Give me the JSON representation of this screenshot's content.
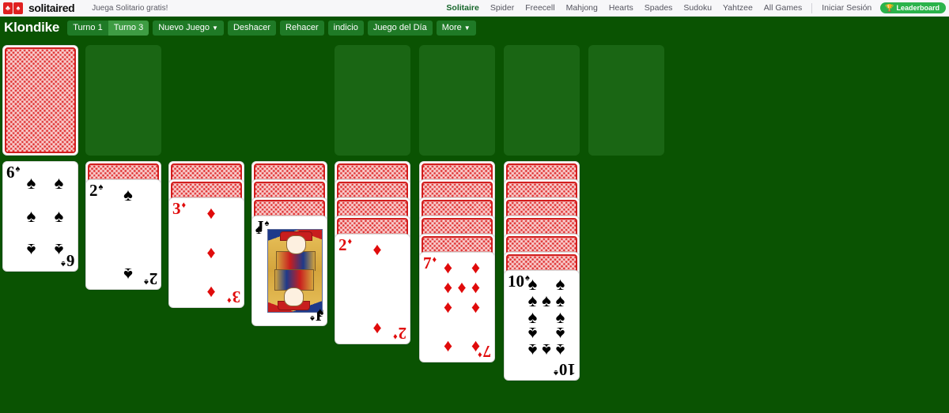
{
  "header": {
    "brand": "solitaired",
    "tagline": "Juega Solitario gratis!",
    "logo_card_1": "club-card-icon",
    "logo_card_2": "spade-card-icon",
    "nav_items": [
      {
        "label": "Solitaire",
        "active": true
      },
      {
        "label": "Spider",
        "active": false
      },
      {
        "label": "Freecell",
        "active": false
      },
      {
        "label": "Mahjong",
        "active": false
      },
      {
        "label": "Hearts",
        "active": false
      },
      {
        "label": "Spades",
        "active": false
      },
      {
        "label": "Sudoku",
        "active": false
      },
      {
        "label": "Yahtzee",
        "active": false
      },
      {
        "label": "All Games",
        "active": false
      }
    ],
    "login_label": "Iniciar Sesión",
    "leaderboard_label": "Leaderboard",
    "leaderboard_icon": "trophy-icon"
  },
  "toolbar": {
    "game_title": "Klondike",
    "turn1_label": "Turno 1",
    "turn3_label": "Turno 3",
    "turn_active": "Turno 3",
    "new_game_label": "Nuevo Juego",
    "undo_label": "Deshacer",
    "redo_label": "Rehacer",
    "hint_label": "indicio",
    "daily_label": "Juego del Día",
    "more_label": "More",
    "caret_icon": "chevron-down-icon"
  },
  "colors": {
    "table_green": "#0a5302",
    "slot_green": "#1a6614",
    "button_green": "#1f7a26",
    "button_active_green": "#3e9c43",
    "accent_green": "#2bb34b",
    "card_red": "#e00b0b",
    "card_back_red": "#e03030"
  },
  "board": {
    "stock": {
      "name": "stock-pile",
      "face_down_count": 1,
      "empty": false
    },
    "waste": {
      "name": "waste-pile",
      "empty": true
    },
    "foundations": [
      {
        "name": "foundation-1",
        "empty": true
      },
      {
        "name": "foundation-2",
        "empty": true
      },
      {
        "name": "foundation-3",
        "empty": true
      },
      {
        "name": "foundation-4",
        "empty": true
      }
    ],
    "tableau": [
      {
        "column": 1,
        "face_down": 0,
        "face_up": [
          {
            "rank": "6",
            "suit": "♠",
            "color": "black",
            "pips": 6
          }
        ]
      },
      {
        "column": 2,
        "face_down": 1,
        "face_up": [
          {
            "rank": "2",
            "suit": "♠",
            "color": "black",
            "pips": 2
          }
        ]
      },
      {
        "column": 3,
        "face_down": 2,
        "face_up": [
          {
            "rank": "3",
            "suit": "♦",
            "color": "red",
            "pips": 3
          }
        ]
      },
      {
        "column": 4,
        "face_down": 3,
        "face_up": [
          {
            "rank": "J",
            "suit": "♠",
            "color": "black",
            "pips": 0
          }
        ]
      },
      {
        "column": 5,
        "face_down": 4,
        "face_up": [
          {
            "rank": "2",
            "suit": "♦",
            "color": "red",
            "pips": 2
          }
        ]
      },
      {
        "column": 6,
        "face_down": 5,
        "face_up": [
          {
            "rank": "7",
            "suit": "♦",
            "color": "red",
            "pips": 7
          }
        ]
      },
      {
        "column": 7,
        "face_down": 6,
        "face_up": [
          {
            "rank": "10",
            "suit": "♠",
            "color": "black",
            "pips": 10
          }
        ]
      }
    ]
  }
}
